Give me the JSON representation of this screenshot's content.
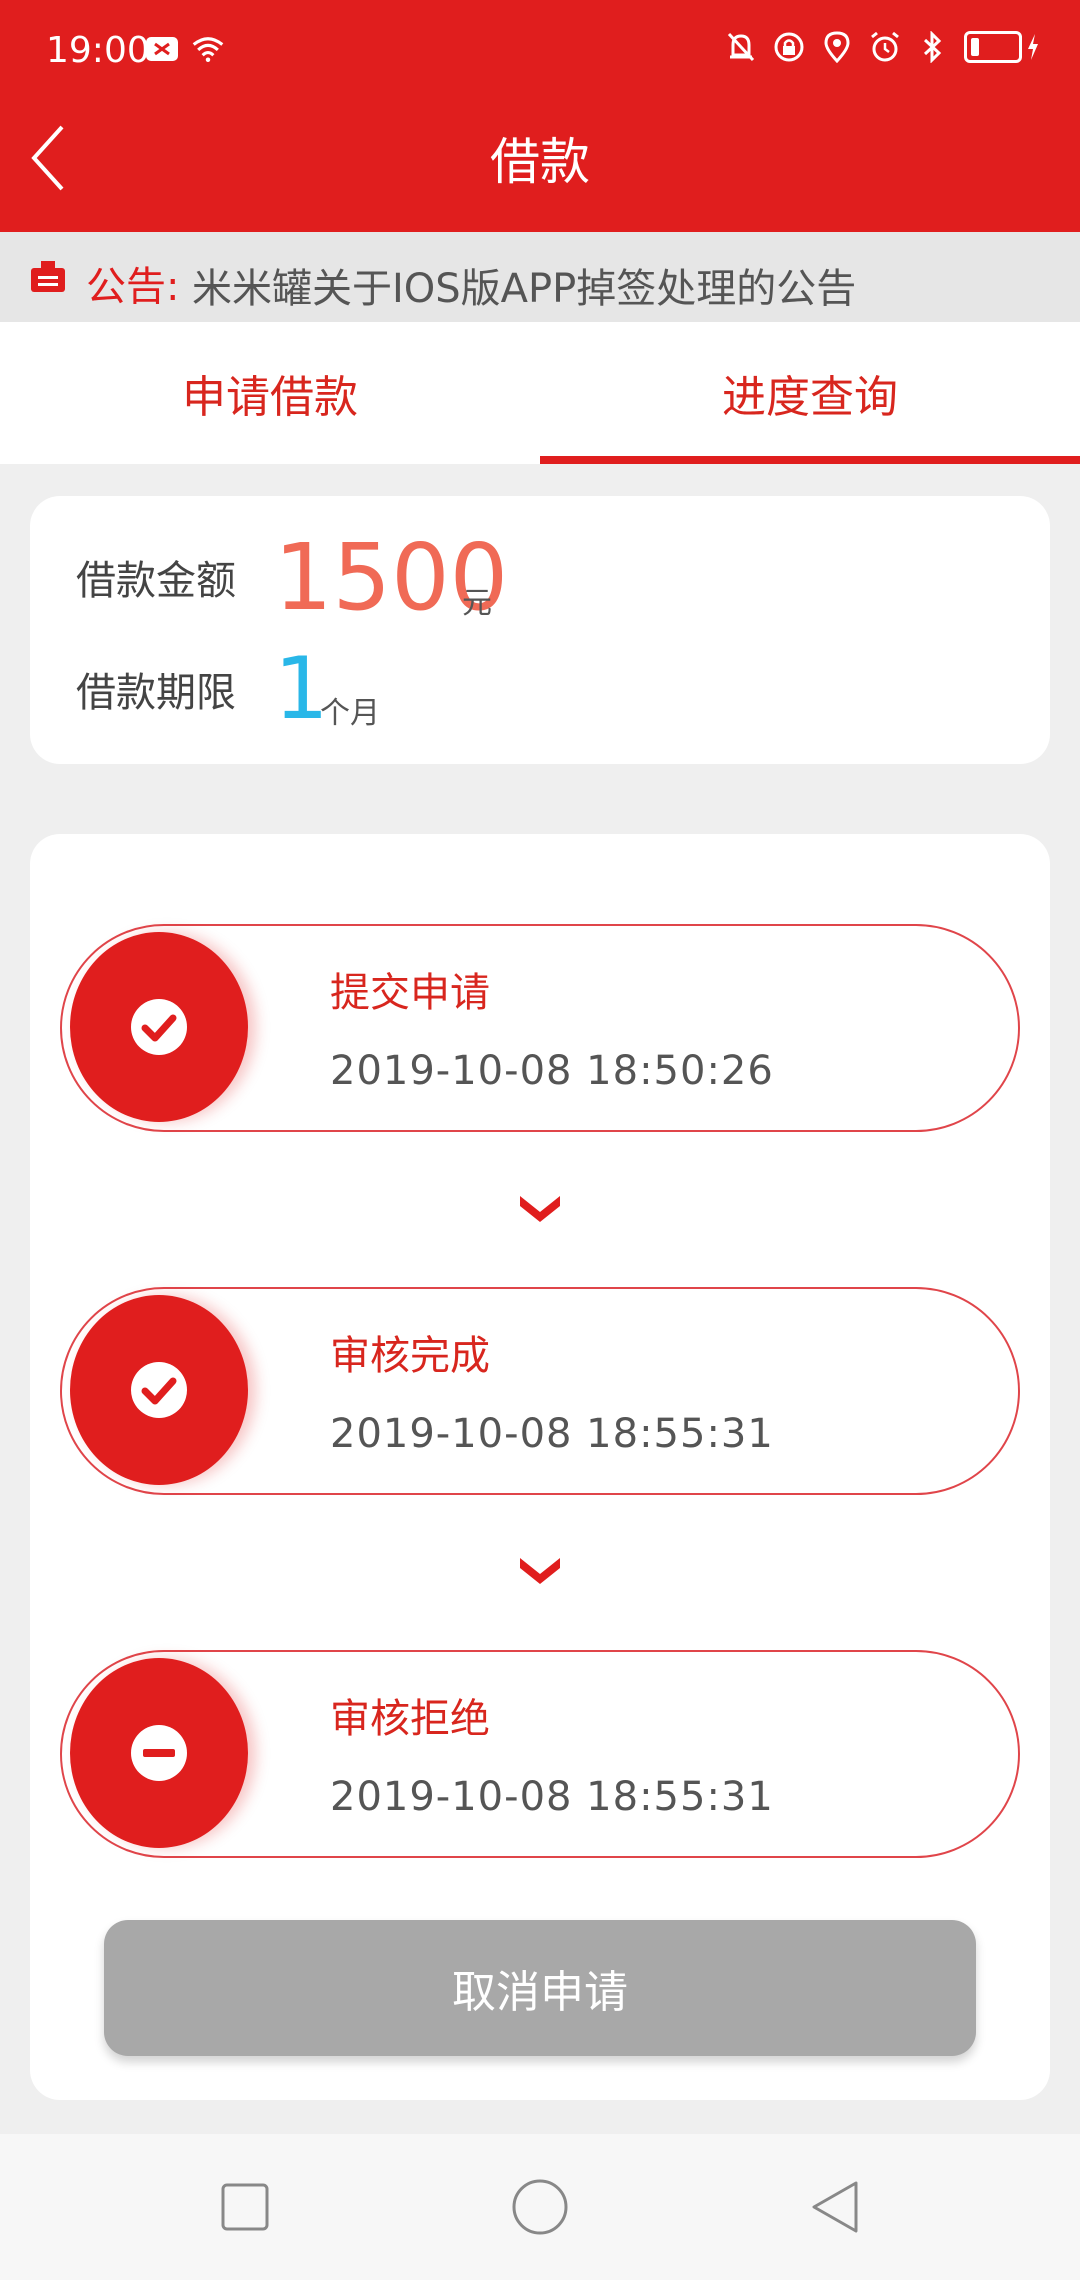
{
  "status_bar": {
    "time": "19:00",
    "icons_left": [
      "message-icon",
      "wifi-icon"
    ],
    "icons_right": [
      "mute-icon",
      "lock-rotation-icon",
      "location-icon",
      "alarm-icon",
      "bluetooth-icon",
      "battery-icon"
    ]
  },
  "header": {
    "title": "借款",
    "back_icon": "chevron-left-icon"
  },
  "notice": {
    "label": "公告:",
    "text": "米米罐关于IOS版APP掉签处理的公告"
  },
  "tabs": [
    {
      "label": "申请借款",
      "active": false
    },
    {
      "label": "进度查询",
      "active": true
    }
  ],
  "summary": {
    "amount_label": "借款金额",
    "amount_value": "1500",
    "amount_unit": "元",
    "term_label": "借款期限",
    "term_value": "1",
    "term_unit": "个月"
  },
  "steps": [
    {
      "title": "提交申请",
      "time": "2019-10-08 18:50:26",
      "icon": "check-icon"
    },
    {
      "title": "审核完成",
      "time": "2019-10-08 18:55:31",
      "icon": "check-icon"
    },
    {
      "title": "审核拒绝",
      "time": "2019-10-08 18:55:31",
      "icon": "minus-icon"
    }
  ],
  "actions": {
    "cancel_label": "取消申请"
  },
  "colors": {
    "brand_red": "#e01e1e",
    "amount_orange": "#f06a56",
    "term_blue": "#29b7e8",
    "disabled_gray": "#a8a8a8"
  }
}
